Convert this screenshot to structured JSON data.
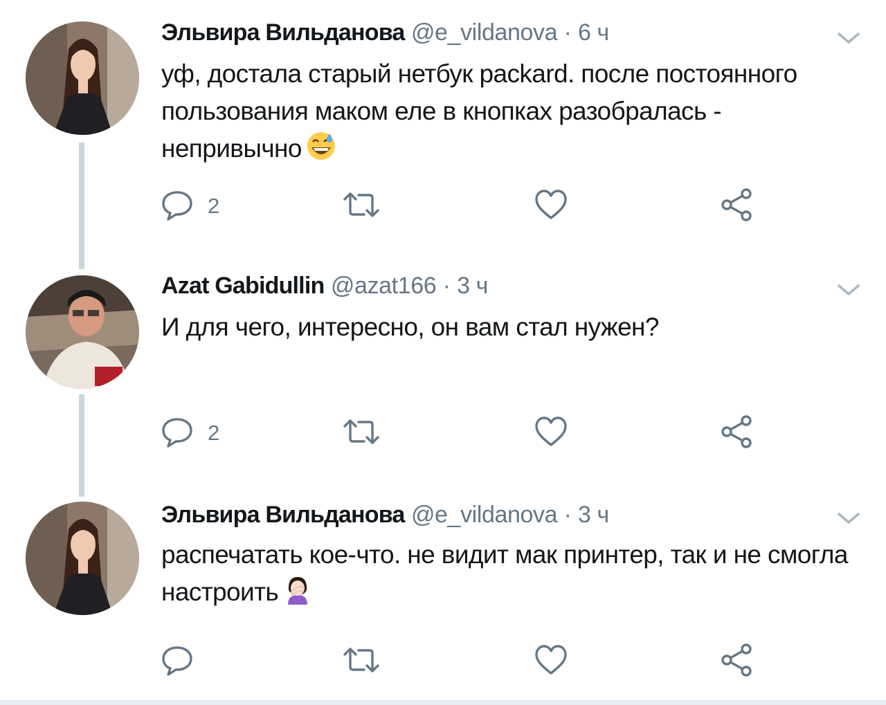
{
  "tweets": [
    {
      "author": {
        "display_name": "Эльвира Вильданова",
        "handle": "@e_vildanova",
        "avatar_icon": "user-avatar-woman"
      },
      "separator": "·",
      "time": "6 ч",
      "text": "уф, достала старый нетбук packard. после постоянного пользования маком еле в кнопках разобралась - непривычно",
      "emoji": "grinning-face-with-sweat",
      "actions": {
        "reply_count": "2",
        "retweet_count": "",
        "like_count": ""
      }
    },
    {
      "author": {
        "display_name": "Azat Gabidullin",
        "handle": "@azat166",
        "avatar_icon": "user-avatar-man"
      },
      "separator": "·",
      "time": "3 ч",
      "text": "И для чего, интересно, он вам стал нужен?",
      "actions": {
        "reply_count": "2",
        "retweet_count": "",
        "like_count": ""
      }
    },
    {
      "author": {
        "display_name": "Эльвира Вильданова",
        "handle": "@e_vildanova",
        "avatar_icon": "user-avatar-woman"
      },
      "separator": "·",
      "time": "3 ч",
      "text": "распечатать кое-что. не видит мак принтер, так и не смогла настроить",
      "emoji": "woman-facepalming",
      "actions": {
        "reply_count": "",
        "retweet_count": "",
        "like_count": ""
      }
    }
  ],
  "colors": {
    "text_primary": "#14171a",
    "text_secondary": "#657786",
    "thread_line": "#ccd6dd",
    "divider": "#e6ecf0"
  }
}
